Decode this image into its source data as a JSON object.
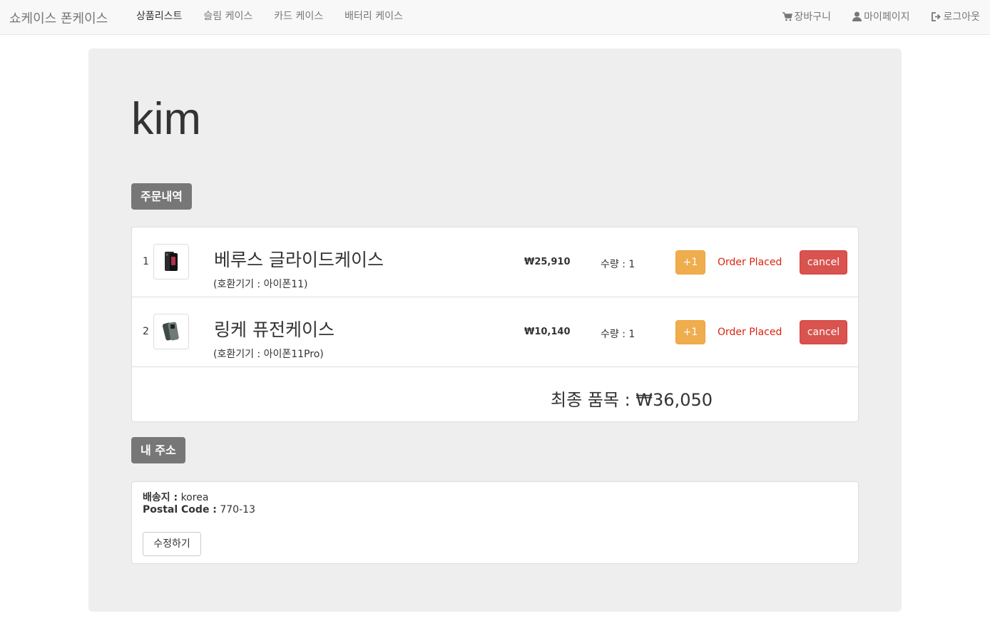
{
  "nav": {
    "brand": "쇼케이스 폰케이스",
    "links": [
      "상품리스트",
      "슬림 케이스",
      "카드 케이스",
      "배터리 케이스"
    ],
    "active_index": 0,
    "cart": "장바구니",
    "mypage": "마이페이지",
    "logout": "로그아웃"
  },
  "user": {
    "name": "kim"
  },
  "orders_section": {
    "label": "주문내역",
    "items": [
      {
        "index": "1",
        "name": "베루스 글라이드케이스",
        "compat": "(호환기기 : 아이폰11)",
        "price": "₩25,910",
        "qty": "수량 : 1",
        "plus_label": "+1",
        "status": "Order Placed",
        "cancel_label": "cancel"
      },
      {
        "index": "2",
        "name": "링케 퓨전케이스",
        "compat": "(호환기기 : 아이폰11Pro)",
        "price": "₩10,140",
        "qty": "수량 : 1",
        "plus_label": "+1",
        "status": "Order Placed",
        "cancel_label": "cancel"
      }
    ],
    "total": "최종 품목 : ₩36,050"
  },
  "address_section": {
    "label": "내 주소",
    "ship_label": "배송지 :",
    "ship_value": "korea",
    "postal_label": "Postal Code :",
    "postal_value": "770-13",
    "edit_label": "수정하기"
  },
  "colors": {
    "warning": "#f0ad4e",
    "danger": "#d9534f",
    "status_red": "#d9230f",
    "label_gray": "#777777"
  },
  "icons": {
    "cart": "cart-icon",
    "user": "user-icon",
    "logout": "logout-icon"
  }
}
